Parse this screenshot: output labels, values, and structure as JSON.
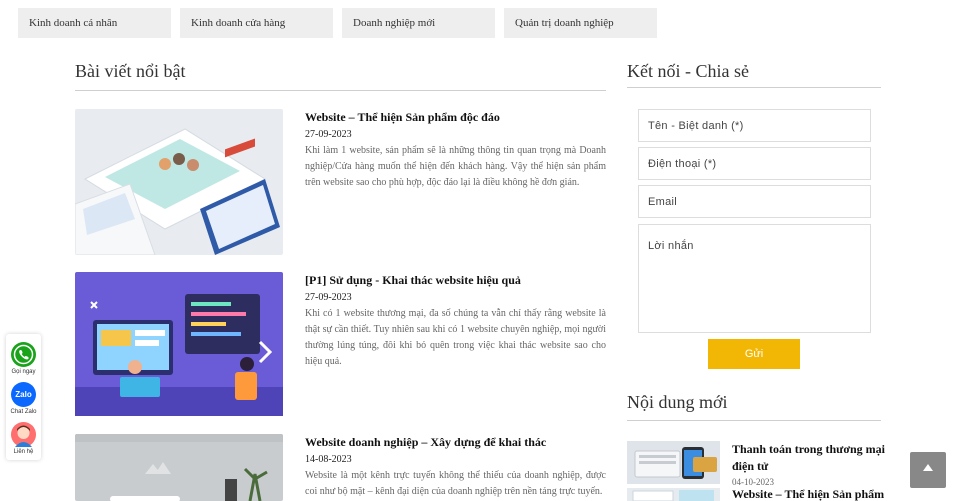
{
  "categories": [
    "Kinh doanh cá nhân",
    "Kinh doanh cửa hàng",
    "Doanh nghiệp mới",
    "Quản trị doanh nghiệp"
  ],
  "featured": {
    "heading": "Bài viết nổi bật",
    "posts": [
      {
        "title": "Website – Thể hiện Sản phẩm độc đáo",
        "date": "27-09-2023",
        "excerpt": "Khi làm 1 website, sản phẩm sẽ là những thông tin quan trọng mà Doanh nghiệp/Cửa hàng muốn thể hiện đến khách hàng. Vậy thể hiện sản phẩm trên website sao cho phù hợp, độc đáo lại là điều không hề đơn giản."
      },
      {
        "title": "[P1] Sử dụng - Khai thác website hiệu quả",
        "date": "27-09-2023",
        "excerpt": "Khi có 1 website thương mại, đa số chúng ta vẫn chỉ thấy rằng website là thật sự cần thiết. Tuy nhiên sau khi có 1 website chuyên nghiệp, mọi người thường lúng túng, đôi khi bỏ quên trong việc khai thác website sao cho hiệu quả."
      },
      {
        "title": "Website doanh nghiệp – Xây dựng để khai thác",
        "date": "14-08-2023",
        "excerpt": "Website là một kênh trực tuyến không thể thiếu của doanh nghiệp, được coi như bộ mặt – kênh đại diện của doanh nghiệp trên nền tảng trực tuyến."
      }
    ]
  },
  "connect": {
    "heading": "Kết nối - Chia sẻ",
    "name_placeholder": "Tên - Biệt danh (*)",
    "phone_placeholder": "Điện thoại (*)",
    "email_placeholder": "Email",
    "message_placeholder": "Lời nhắn",
    "submit_label": "Gửi"
  },
  "latest": {
    "heading": "Nội dung mới",
    "items": [
      {
        "title": "Thanh toán trong thương mại điện tử",
        "date": "04-10-2023"
      },
      {
        "title": "Website – Thể hiện Sản phẩm",
        "date": ""
      }
    ]
  },
  "floating": {
    "call_label": "Gọi ngay",
    "zalo_label": "Chat Zalo",
    "zalo_icon_text": "Zalo",
    "contact_label": "Liên hệ"
  },
  "colors": {
    "accent": "#f2b705",
    "call_green": "#1aa31a",
    "zalo_blue": "#0a68ff",
    "back_to_top": "#888888"
  },
  "icons": [
    "phone-icon",
    "zalo-icon",
    "contact-avatar-icon",
    "arrow-up-icon"
  ]
}
